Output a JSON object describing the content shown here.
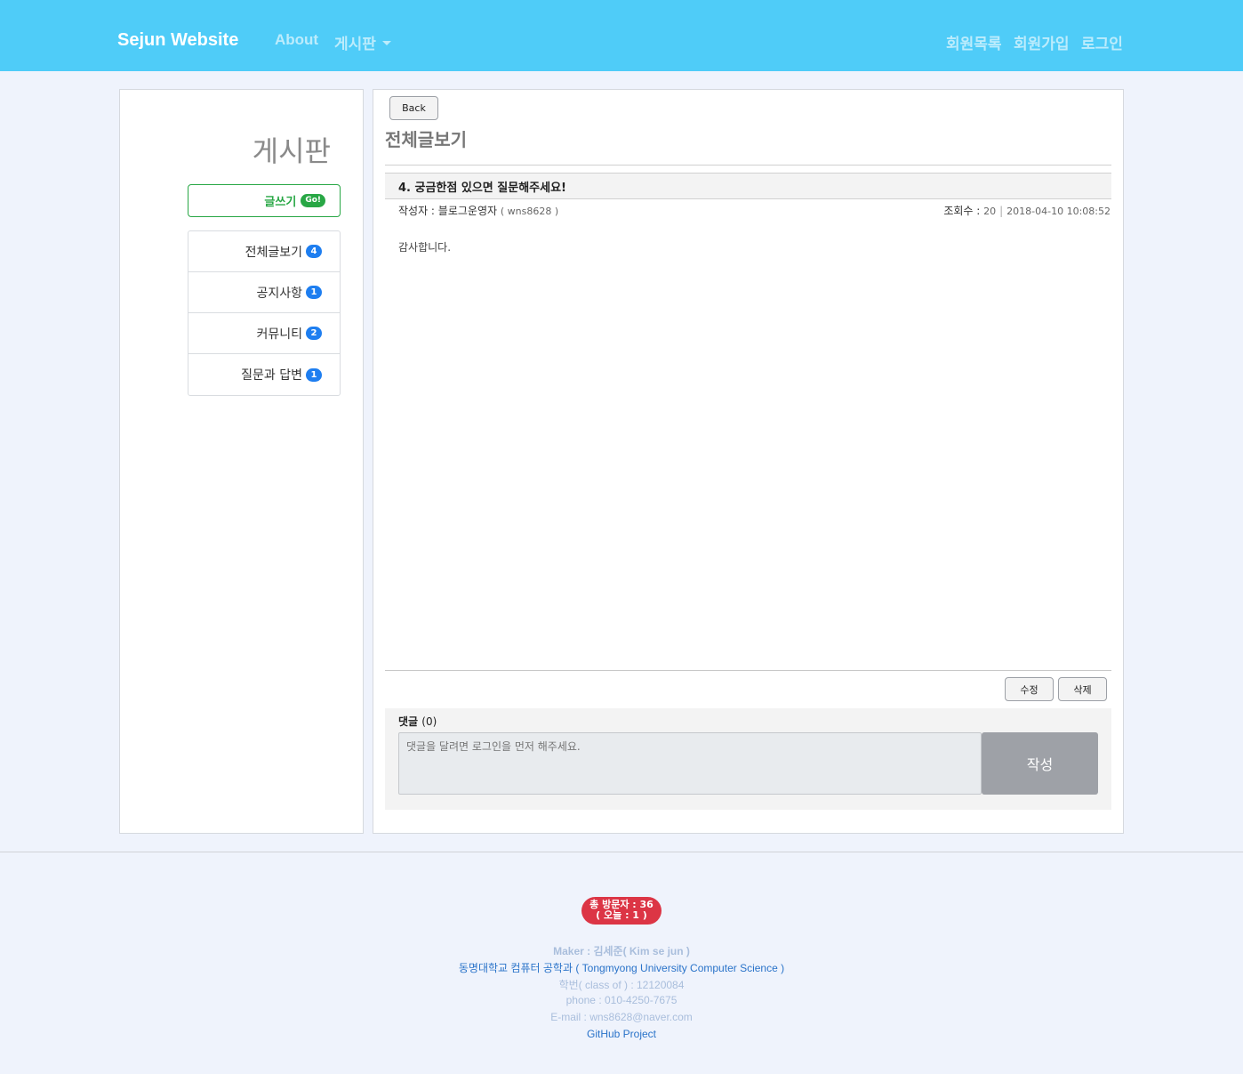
{
  "navbar": {
    "brand": "Sejun Website",
    "about": "About",
    "board": "게시판",
    "members": "회원목록",
    "signup": "회원가입",
    "login": "로그인",
    "bg_color": "#4fccf8"
  },
  "sidebar": {
    "title": "게시판",
    "write_label": "글쓰기",
    "write_badge": "Go!",
    "items": [
      {
        "label": "전체글보기",
        "count": "4"
      },
      {
        "label": "공지사항",
        "count": "1"
      },
      {
        "label": "커뮤니티",
        "count": "2"
      },
      {
        "label": "질문과 답변",
        "count": "1"
      }
    ]
  },
  "main": {
    "back_label": "Back",
    "heading": "전체글보기",
    "post": {
      "title": "4. 궁금한점 있으면 질문해주세요!",
      "author_label": "작성자 : ",
      "author_name": "블로그운영자",
      "author_id": "( wns8628 )",
      "views_label": "조회수 : ",
      "views": "20",
      "separator": "|",
      "date": "2018-04-10 10:08:52",
      "body": "감사합니다."
    },
    "edit_label": "수정",
    "delete_label": "삭제",
    "comments": {
      "label": "댓글",
      "count": "(0)",
      "placeholder": "댓글을 달려면 로그인을 먼저 해주세요.",
      "submit_label": "작성"
    }
  },
  "footer": {
    "visitors_total": "총 방문자 : 36",
    "visitors_today": "( 오늘 : 1 )",
    "maker": "Maker : 김세준( Kim se jun )",
    "university": "동명대학교 컴퓨터 공학과 ( Tongmyong University Computer Science )",
    "class": "학번( class of ) : 12120084",
    "phone": "phone : 010-4250-7675",
    "email": "E-mail : wns8628@naver.com",
    "github": "GitHub Project"
  }
}
